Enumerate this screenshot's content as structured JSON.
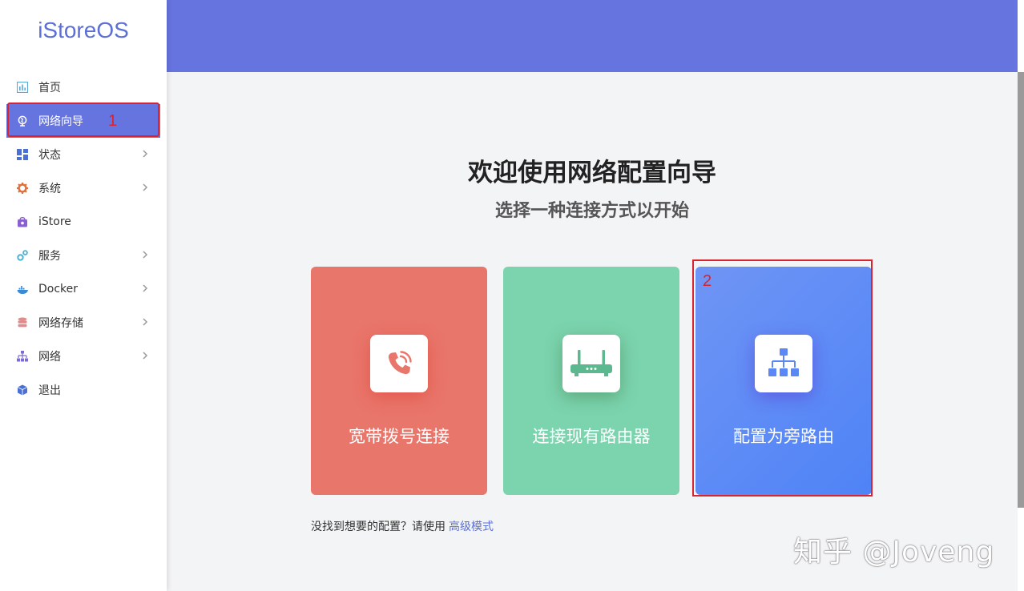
{
  "sidebar": {
    "logo": "iStoreOS",
    "items": [
      {
        "label": "首页",
        "icon": "dashboard-icon",
        "chevron": false
      },
      {
        "label": "网络向导",
        "icon": "globe-icon",
        "chevron": false,
        "active": true
      },
      {
        "label": "状态",
        "icon": "grid-icon",
        "chevron": true
      },
      {
        "label": "系统",
        "icon": "gear-icon",
        "chevron": true
      },
      {
        "label": "iStore",
        "icon": "store-bag-icon",
        "chevron": false
      },
      {
        "label": "服务",
        "icon": "gears-icon",
        "chevron": true
      },
      {
        "label": "Docker",
        "icon": "docker-whale-icon",
        "chevron": true
      },
      {
        "label": "网络存储",
        "icon": "database-icon",
        "chevron": true
      },
      {
        "label": "网络",
        "icon": "network-tree-icon",
        "chevron": true
      },
      {
        "label": "退出",
        "icon": "cube-icon",
        "chevron": false
      }
    ]
  },
  "annotations": {
    "one": "1",
    "two": "2"
  },
  "main": {
    "title": "欢迎使用网络配置向导",
    "subtitle": "选择一种连接方式以开始",
    "cards": [
      {
        "label": "宽带拨号连接",
        "icon": "phone-ringing-icon",
        "color": "#e9766b"
      },
      {
        "label": "连接现有路由器",
        "icon": "router-icon",
        "color": "#7bd4ae"
      },
      {
        "label": "配置为旁路由",
        "icon": "network-hierarchy-icon",
        "color": "#5b88f5"
      }
    ],
    "footer_text": "没找到想要的配置？请使用",
    "footer_link": "高级模式"
  },
  "colors": {
    "accent": "#6674e0",
    "annotation": "#d9232e"
  },
  "watermark": "知乎 @Joveng"
}
